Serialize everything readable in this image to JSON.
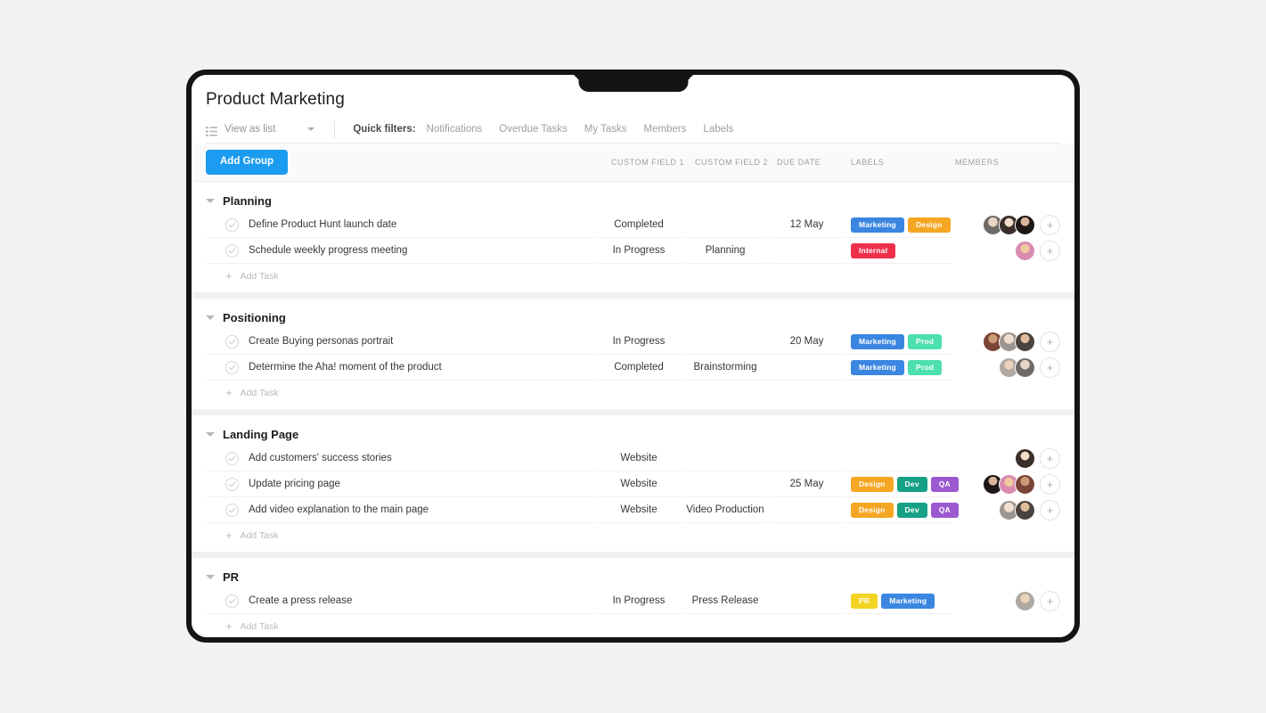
{
  "header": {
    "title": "Product Marketing",
    "view_selector": {
      "icon": "list-icon",
      "label": "View as list"
    },
    "quick_filters_label": "Quick filters:",
    "quick_filters": [
      "Notifications",
      "Overdue Tasks",
      "My Tasks",
      "Members",
      "Labels"
    ]
  },
  "toolbar": {
    "add_group_label": "Add Group",
    "columns": [
      "CUSTOM FIELD 1",
      "CUSTOM FIELD 2",
      "DUE DATE",
      "LABELS",
      "MEMBERS"
    ]
  },
  "colors": {
    "accent": "#1b9cf0",
    "marketing": "#3b86e0",
    "design": "#f5a623",
    "internal": "#f0304b",
    "prod": "#4ddfb0",
    "dev": "#16a085",
    "qa": "#9b59d0",
    "pr": "#f3d424"
  },
  "add_task_label": "Add Task",
  "groups": [
    {
      "name": "Planning",
      "tasks": [
        {
          "name": "Define Product Hunt launch date",
          "custom_field_1": "Completed",
          "custom_field_2": "",
          "due_date": "12 May",
          "labels": [
            {
              "text": "Marketing",
              "color": "#3b86e0"
            },
            {
              "text": "Design",
              "color": "#f5a623"
            }
          ],
          "members": 3
        },
        {
          "name": "Schedule weekly progress meeting",
          "custom_field_1": "In Progress",
          "custom_field_2": "Planning",
          "due_date": "",
          "labels": [
            {
              "text": "Internal",
              "color": "#f0304b"
            }
          ],
          "members": 1
        }
      ]
    },
    {
      "name": "Positioning",
      "tasks": [
        {
          "name": "Create Buying personas portrait",
          "custom_field_1": "In Progress",
          "custom_field_2": "",
          "due_date": "20 May",
          "labels": [
            {
              "text": "Marketing",
              "color": "#3b86e0"
            },
            {
              "text": "Prod",
              "color": "#4ddfb0"
            }
          ],
          "members": 3
        },
        {
          "name": "Determine the Aha! moment of the product",
          "custom_field_1": "Completed",
          "custom_field_2": "Brainstorming",
          "due_date": "",
          "labels": [
            {
              "text": "Marketing",
              "color": "#3b86e0"
            },
            {
              "text": "Prod",
              "color": "#4ddfb0"
            }
          ],
          "members": 2
        }
      ]
    },
    {
      "name": "Landing Page",
      "tasks": [
        {
          "name": "Add customers' success stories",
          "custom_field_1": "Website",
          "custom_field_2": "",
          "due_date": "",
          "labels": [],
          "members": 1
        },
        {
          "name": "Update pricing page",
          "custom_field_1": "Website",
          "custom_field_2": "",
          "due_date": "25 May",
          "labels": [
            {
              "text": "Design",
              "color": "#f5a623"
            },
            {
              "text": "Dev",
              "color": "#16a085"
            },
            {
              "text": "QA",
              "color": "#9b59d0"
            }
          ],
          "members": 3
        },
        {
          "name": "Add video explanation to the main page",
          "custom_field_1": "Website",
          "custom_field_2": "Video Production",
          "due_date": "",
          "labels": [
            {
              "text": "Design",
              "color": "#f5a623"
            },
            {
              "text": "Dev",
              "color": "#16a085"
            },
            {
              "text": "QA",
              "color": "#9b59d0"
            }
          ],
          "members": 2
        }
      ]
    },
    {
      "name": "PR",
      "tasks": [
        {
          "name": "Create a press release",
          "custom_field_1": "In Progress",
          "custom_field_2": "Press Release",
          "due_date": "",
          "labels": [
            {
              "text": "PR",
              "color": "#f3d424"
            },
            {
              "text": "Marketing",
              "color": "#3b86e0"
            }
          ],
          "members": 1
        }
      ]
    }
  ]
}
